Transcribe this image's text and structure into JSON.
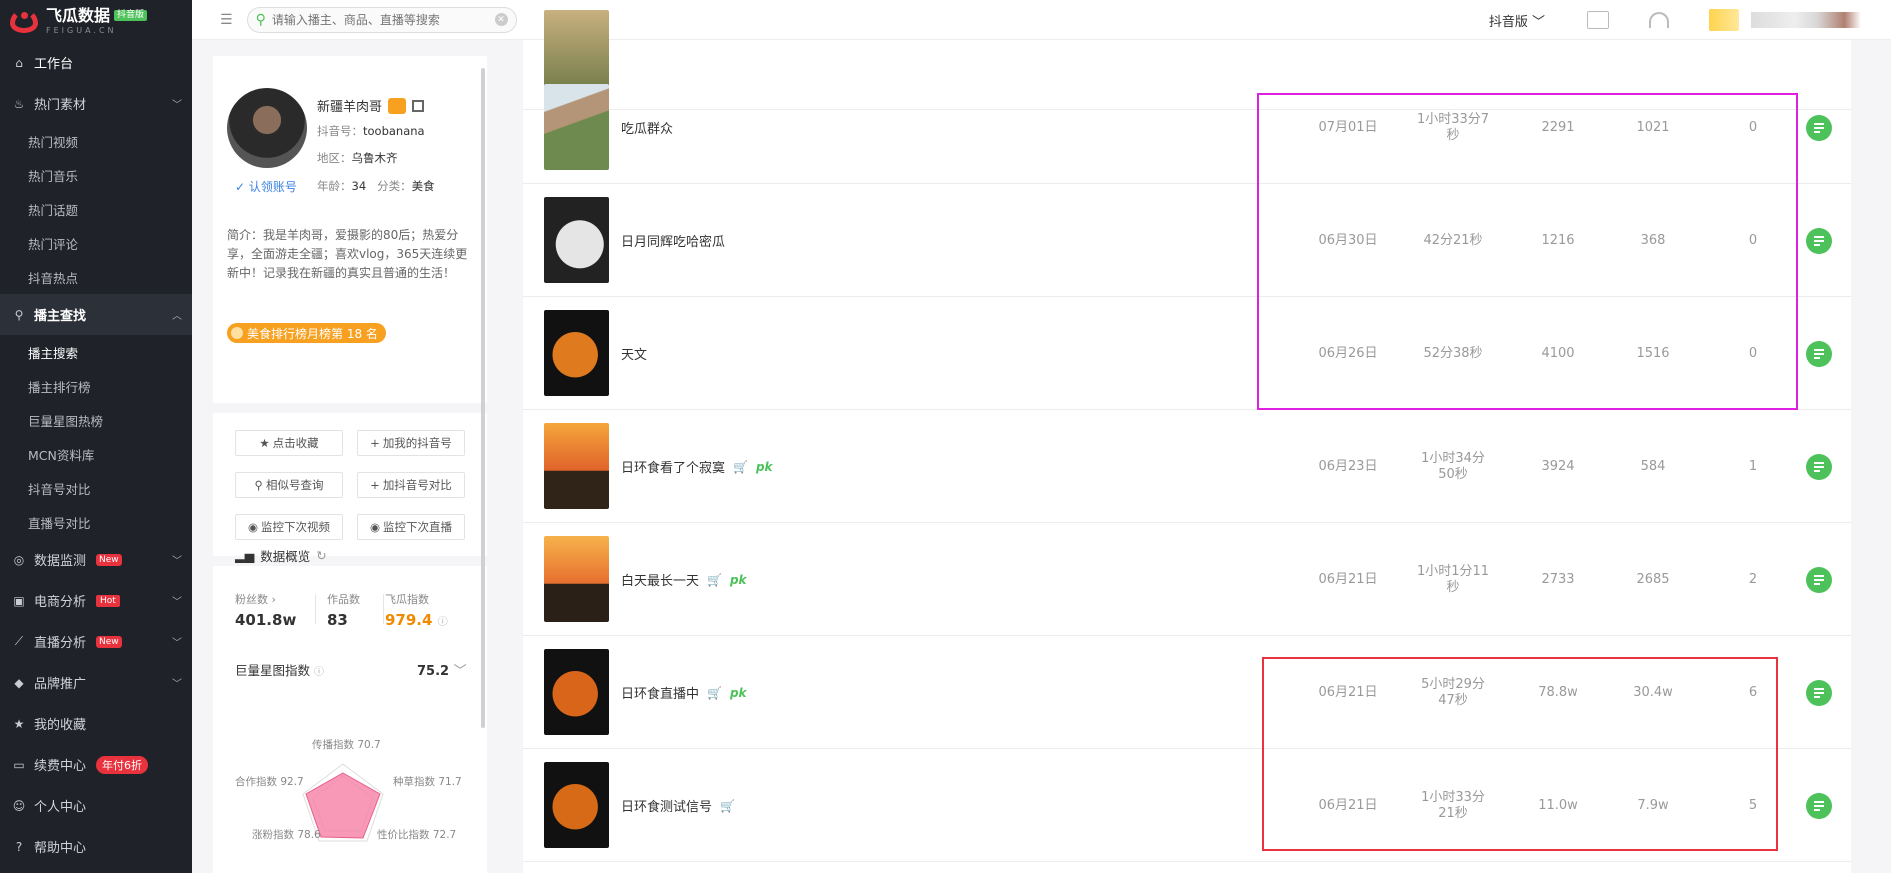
{
  "brand": {
    "title": "飞瓜数据",
    "badge": "抖音版",
    "subtitle": "FEIGUA.CN"
  },
  "nav": {
    "workbench": "工作台",
    "hot_material": "热门素材",
    "hot_subs": [
      "热门视频",
      "热门音乐",
      "热门话题",
      "热门评论",
      "抖音热点"
    ],
    "streamer_search": "播主查找",
    "search_subs": [
      "播主搜索",
      "播主排行榜",
      "巨量星图热榜",
      "MCN资料库",
      "抖音号对比",
      "直播号对比"
    ],
    "data_monitor": "数据监测",
    "data_monitor_badge": "New",
    "ecom": "电商分析",
    "ecom_badge": "Hot",
    "live": "直播分析",
    "live_badge": "New",
    "brand_promo": "品牌推广",
    "favorites": "我的收藏",
    "renew": "续费中心",
    "renew_badge": "年付6折",
    "personal": "个人中心",
    "help": "帮助中心"
  },
  "topbar": {
    "search_placeholder": "请输入播主、商品、直播等搜索",
    "version": "抖音版"
  },
  "profile": {
    "name": "新疆羊肉哥",
    "douyin_id_label": "抖音号：",
    "douyin_id": "toobanana",
    "region_label": "地区：",
    "region": "乌鲁木齐",
    "claim": "认领账号",
    "age_label": "年龄：",
    "age": "34",
    "category_label": "分类：",
    "category": "美食",
    "bio": "简介：我是羊肉哥，爱摄影的80后；热爱分享，全面游走全疆；喜欢vlog，365天连续更新中！记录我在新疆的真实且普通的生活！",
    "rank": "美食排行榜月榜第 18 名",
    "buttons": [
      "点击收藏",
      "加我的抖音号",
      "相似号查询",
      "加抖音号对比",
      "监控下次视频",
      "监控下次直播"
    ],
    "overview_title": "数据概览",
    "fans_label": "粉丝数",
    "fans": "401.8w",
    "works_label": "作品数",
    "works": "83",
    "index_label": "飞瓜指数",
    "index": "979.4",
    "star_label": "巨量星图指数",
    "star_value": "75.2",
    "radar": {
      "spread": "传播指数 70.7",
      "cooperate": "合作指数 92.7",
      "grass": "种草指数 71.7",
      "fans_growth": "涨粉指数 78.6",
      "value": "性价比指数 72.7"
    }
  },
  "rows": [
    {
      "title": "吃瓜群众",
      "date": "07月01日",
      "duration": [
        "1小时33分7",
        "秒"
      ],
      "a": "2291",
      "b": "1021",
      "c": "0",
      "cart": false,
      "pk": false
    },
    {
      "title": "日月同辉吃哈密瓜",
      "date": "06月30日",
      "duration": [
        "42分21秒"
      ],
      "a": "1216",
      "b": "368",
      "c": "0",
      "cart": false,
      "pk": false
    },
    {
      "title": "天文",
      "date": "06月26日",
      "duration": [
        "52分38秒"
      ],
      "a": "4100",
      "b": "1516",
      "c": "0",
      "cart": false,
      "pk": false
    },
    {
      "title": "日环食看了个寂寞",
      "date": "06月23日",
      "duration": [
        "1小时34分",
        "50秒"
      ],
      "a": "3924",
      "b": "584",
      "c": "1",
      "cart": true,
      "pk": true
    },
    {
      "title": "白天最长一天",
      "date": "06月21日",
      "duration": [
        "1小时1分11",
        "秒"
      ],
      "a": "2733",
      "b": "2685",
      "c": "2",
      "cart": true,
      "pk": true
    },
    {
      "title": "日环食直播中",
      "date": "06月21日",
      "duration": [
        "5小时29分",
        "47秒"
      ],
      "a": "78.8w",
      "b": "30.4w",
      "c": "6",
      "cart": true,
      "pk": true
    },
    {
      "title": "日环食测试信号",
      "date": "06月21日",
      "duration": [
        "1小时33分",
        "21秒"
      ],
      "a": "11.0w",
      "b": "7.9w",
      "c": "5",
      "cart": true,
      "pk": false
    }
  ],
  "pk_label": "pk",
  "colors": {
    "accent": "#4ec25a",
    "brand_red": "#e8323d",
    "orange": "#f8a020",
    "highlight_magenta": "#e020e0"
  }
}
